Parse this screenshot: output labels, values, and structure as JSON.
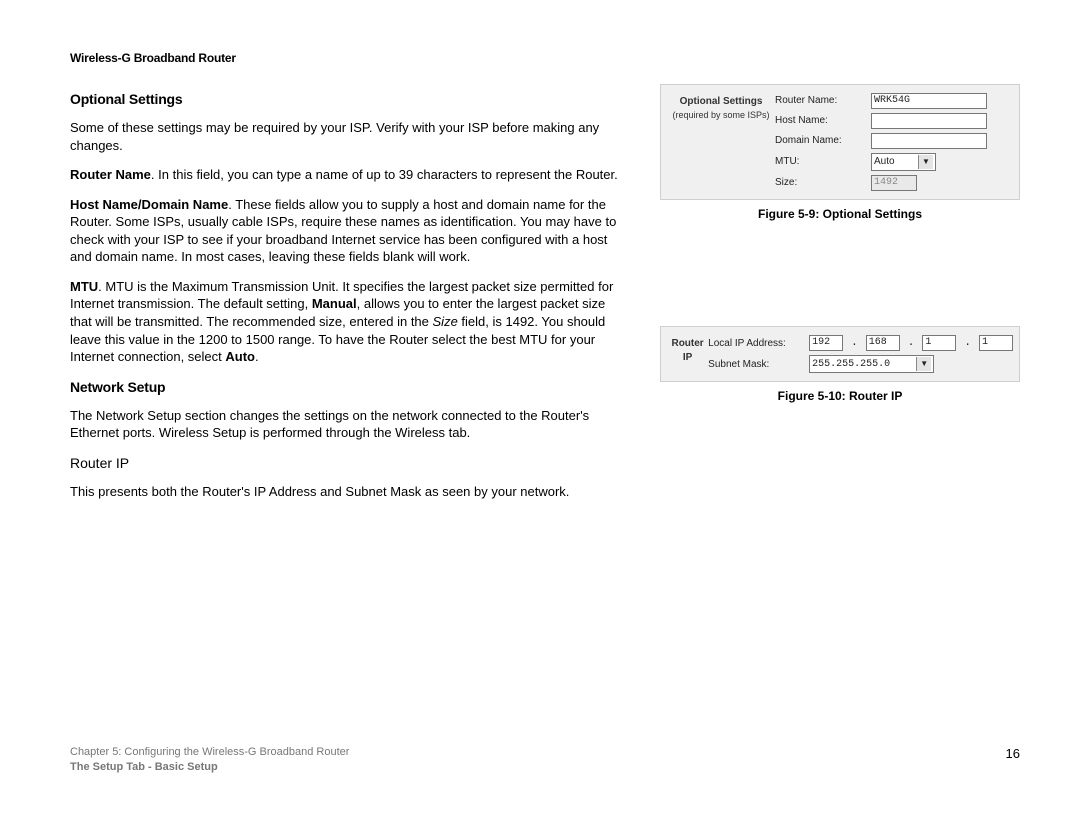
{
  "header": "Wireless-G Broadband Router",
  "sections": {
    "optional_title": "Optional Settings",
    "intro": "Some of these settings may be required by your ISP. Verify with your ISP before making any changes.",
    "router_name_label": "Router Name",
    "router_name_text": ". In this field, you can type a name of up to 39 characters to represent the Router.",
    "host_label": "Host Name/Domain Name",
    "host_text": ". These fields allow you to supply a host and domain name for the Router. Some ISPs, usually cable ISPs, require these names as identification. You may have to check with your ISP to see if your broadband Internet service has been configured with a host and domain name. In most cases, leaving these fields blank will work.",
    "mtu_label": "MTU",
    "mtu_text_1": ". MTU is the Maximum Transmission Unit. It specifies the largest packet size permitted for Internet transmission. The default setting, ",
    "mtu_manual": "Manual",
    "mtu_text_2": ", allows you to enter the largest packet size that will be transmitted. The recommended size, entered in the ",
    "mtu_size_word": "Size",
    "mtu_text_3": " field, is 1492. You should leave this value in the 1200 to 1500 range. To have the Router select the best MTU for your Internet connection, select ",
    "mtu_auto": "Auto",
    "mtu_text_4": ".",
    "network_title": "Network Setup",
    "network_intro": "The Network Setup section changes the settings on the network connected to the Router's Ethernet ports. Wireless Setup is performed through the Wireless tab.",
    "routerip_title": "Router IP",
    "routerip_text": "This presents both the Router's IP Address and Subnet Mask as seen by your network."
  },
  "fig1": {
    "section_label": "Optional Settings",
    "section_sub": "(required by some ISPs)",
    "router_name_lbl": "Router Name:",
    "router_name_val": "WRK54G",
    "host_name_lbl": "Host Name:",
    "domain_name_lbl": "Domain Name:",
    "mtu_lbl": "MTU:",
    "mtu_val": "Auto",
    "size_lbl": "Size:",
    "size_val": "1492",
    "caption": "Figure 5-9: Optional Settings"
  },
  "fig2": {
    "section_label": "Router IP",
    "local_ip_lbl": "Local IP Address:",
    "ip": [
      "192",
      "168",
      "1",
      "1"
    ],
    "subnet_lbl": "Subnet Mask:",
    "subnet_val": "255.255.255.0",
    "caption": "Figure 5-10: Router IP"
  },
  "footer": {
    "chapter": "Chapter 5: Configuring the Wireless-G Broadband Router",
    "sub": "The Setup Tab - Basic Setup",
    "page": "16"
  }
}
